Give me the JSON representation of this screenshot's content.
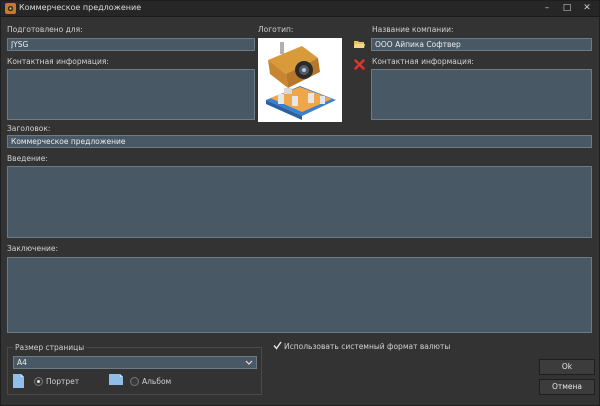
{
  "window": {
    "title": "Коммерческое предложение"
  },
  "form": {
    "prepared_for_label": "Подготовлено для:",
    "prepared_for_value": "JYSG",
    "contact_left_label": "Контактная информация:",
    "contact_left_value": "",
    "logo_label": "Логотип:",
    "company_name_label": "Название компании:",
    "company_name_value": "ООО Айпика Софтвер",
    "contact_right_label": "Контактная информация:",
    "contact_right_value": "",
    "heading_label": "Заголовок:",
    "heading_value": "Коммерческое предложение",
    "intro_label": "Введение:",
    "intro_value": "",
    "conclusion_label": "Заключение:",
    "conclusion_value": ""
  },
  "page_size": {
    "group_label": "Размер страницы",
    "selected": "A4",
    "portrait_label": "Портрет",
    "landscape_label": "Альбом",
    "orientation": "portrait"
  },
  "currency_checkbox": {
    "label": "Использовать системный формат валюты",
    "checked": true
  },
  "buttons": {
    "ok": "Ok",
    "cancel": "Отмена"
  },
  "icons": {
    "app": "app-logo-icon",
    "open_folder": "folder-open-icon",
    "clear": "delete-x-icon",
    "logo_image": "security-camera-logo",
    "portrait": "portrait-page-icon",
    "landscape": "landscape-page-icon"
  },
  "colors": {
    "field_bg": "#495865",
    "window_bg": "#333333",
    "titlebar_bg": "#262626",
    "clear_red": "#d63a2a",
    "folder_yellow": "#e8c25a"
  }
}
